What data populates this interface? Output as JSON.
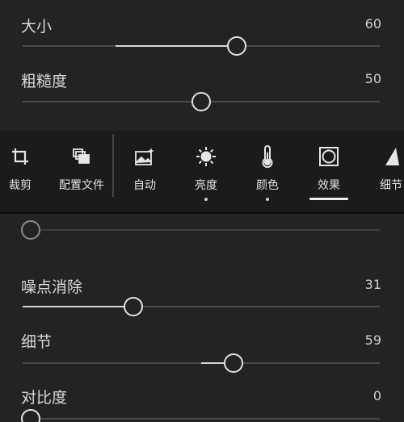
{
  "top_sliders": [
    {
      "label": "大小",
      "value": "60",
      "level": 0.6,
      "fill_from": 0.26
    },
    {
      "label": "粗糙度",
      "value": "50",
      "level": 0.5,
      "fill_from": 0.5
    }
  ],
  "toolbar": {
    "items": [
      {
        "label": "裁剪",
        "icon": "crop-icon"
      },
      {
        "label": "配置文件",
        "icon": "profiles-icon"
      },
      {
        "label": "自动",
        "icon": "auto-icon"
      },
      {
        "label": "亮度",
        "icon": "sun-icon",
        "indicator": "dot"
      },
      {
        "label": "颜色",
        "icon": "thermometer-icon",
        "indicator": "dot"
      },
      {
        "label": "效果",
        "icon": "effects-icon",
        "indicator": "underline",
        "active": true
      },
      {
        "label": "细节",
        "icon": "triangle-icon"
      }
    ]
  },
  "bottom_sliders": [
    {
      "label": "噪点消除",
      "value": "31",
      "level": 0.31
    },
    {
      "label": "细节",
      "value": "59",
      "level": 0.59
    },
    {
      "label": "对比度",
      "value": "0",
      "level": 0.0
    }
  ],
  "partial_slider": {
    "level": 0.0
  }
}
